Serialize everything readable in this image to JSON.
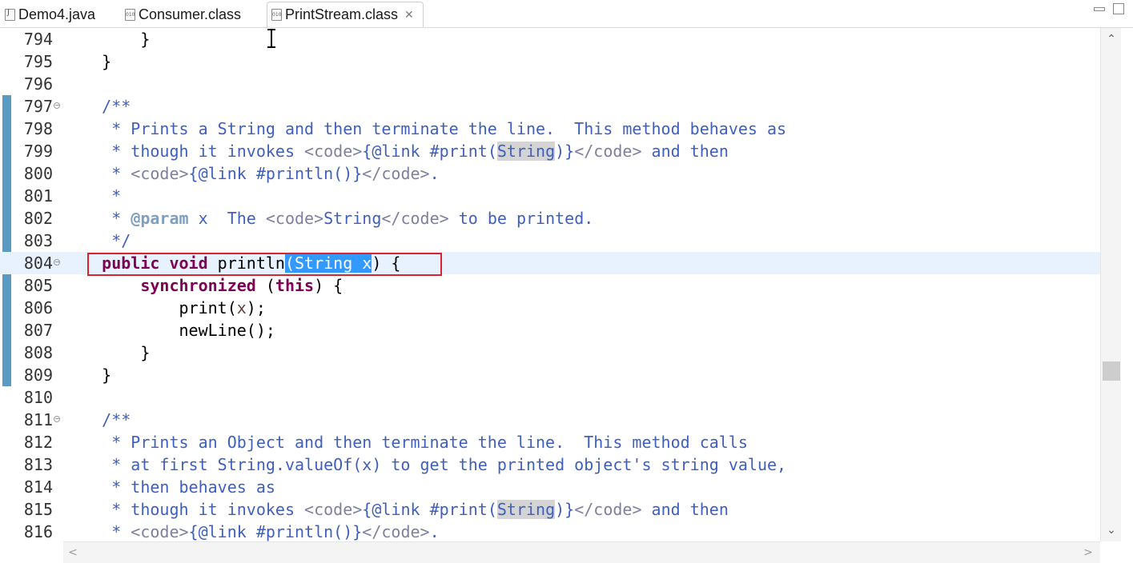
{
  "tabs": [
    {
      "label": "Demo4.java",
      "icon": "java-file-icon",
      "active": false
    },
    {
      "label": "Consumer.class",
      "icon": "class-file-icon",
      "active": false
    },
    {
      "label": "PrintStream.class",
      "icon": "class-file-icon",
      "active": true,
      "close": "✕"
    }
  ],
  "editor": {
    "current_line": 804,
    "lines": [
      {
        "n": "794",
        "tokens": [
          [
            "p",
            "        }"
          ]
        ]
      },
      {
        "n": "795",
        "tokens": [
          [
            "p",
            "    }"
          ]
        ]
      },
      {
        "n": "796",
        "tokens": []
      },
      {
        "n": "797",
        "fold": true,
        "tokens": [
          [
            "d",
            "    /**"
          ]
        ]
      },
      {
        "n": "798",
        "tokens": [
          [
            "d",
            "     * Prints a String and then terminate the line.  This method behaves as"
          ]
        ]
      },
      {
        "n": "799",
        "tokens": [
          [
            "d",
            "     * though it invokes "
          ],
          [
            "t",
            "<code>"
          ],
          [
            "d",
            "{@link #print("
          ],
          [
            "o",
            "String"
          ],
          [
            "d",
            ")}"
          ],
          [
            "t",
            "</code>"
          ],
          [
            "d",
            " and then"
          ]
        ]
      },
      {
        "n": "800",
        "tokens": [
          [
            "d",
            "     * "
          ],
          [
            "t",
            "<code>"
          ],
          [
            "d",
            "{@link #println()}"
          ],
          [
            "t",
            "</code>"
          ],
          [
            "d",
            "."
          ]
        ]
      },
      {
        "n": "801",
        "tokens": [
          [
            "d",
            "     *"
          ]
        ]
      },
      {
        "n": "802",
        "tokens": [
          [
            "d",
            "     * "
          ],
          [
            "b",
            "@param"
          ],
          [
            "d",
            " x  The "
          ],
          [
            "t",
            "<code>"
          ],
          [
            "d",
            "String"
          ],
          [
            "t",
            "</code>"
          ],
          [
            "d",
            " to be printed."
          ]
        ]
      },
      {
        "n": "803",
        "tokens": [
          [
            "d",
            "     */"
          ]
        ]
      },
      {
        "n": "804",
        "fold": true,
        "tokens": [
          [
            "p",
            "    "
          ],
          [
            "k",
            "public"
          ],
          [
            "p",
            " "
          ],
          [
            "k",
            "void"
          ],
          [
            "p",
            " println"
          ],
          [
            "s",
            "(String x"
          ],
          [
            "p",
            ") {"
          ]
        ]
      },
      {
        "n": "805",
        "tokens": [
          [
            "p",
            "        "
          ],
          [
            "k",
            "synchronized"
          ],
          [
            "p",
            " ("
          ],
          [
            "k",
            "this"
          ],
          [
            "p",
            ") {"
          ]
        ]
      },
      {
        "n": "806",
        "tokens": [
          [
            "p",
            "            print("
          ],
          [
            "v",
            "x"
          ],
          [
            "p",
            ");"
          ]
        ]
      },
      {
        "n": "807",
        "tokens": [
          [
            "p",
            "            newLine();"
          ]
        ]
      },
      {
        "n": "808",
        "tokens": [
          [
            "p",
            "        }"
          ]
        ]
      },
      {
        "n": "809",
        "tokens": [
          [
            "p",
            "    }"
          ]
        ]
      },
      {
        "n": "810",
        "tokens": []
      },
      {
        "n": "811",
        "fold": true,
        "tokens": [
          [
            "d",
            "    /**"
          ]
        ]
      },
      {
        "n": "812",
        "tokens": [
          [
            "d",
            "     * Prints an Object and then terminate the line.  This method calls"
          ]
        ]
      },
      {
        "n": "813",
        "tokens": [
          [
            "d",
            "     * at first String.valueOf(x) to get the printed object's string value,"
          ]
        ]
      },
      {
        "n": "814",
        "tokens": [
          [
            "d",
            "     * then behaves as"
          ]
        ]
      },
      {
        "n": "815",
        "tokens": [
          [
            "d",
            "     * though it invokes "
          ],
          [
            "t",
            "<code>"
          ],
          [
            "d",
            "{@link #print("
          ],
          [
            "o",
            "String"
          ],
          [
            "d",
            ")}"
          ],
          [
            "t",
            "</code>"
          ],
          [
            "d",
            " and then"
          ]
        ]
      },
      {
        "n": "816",
        "tokens": [
          [
            "d",
            "     * "
          ],
          [
            "t",
            "<code>"
          ],
          [
            "d",
            "{@link #println()}"
          ],
          [
            "t",
            "</code>"
          ],
          [
            "d",
            "."
          ]
        ]
      }
    ]
  },
  "scrollbar": {
    "vertical_position": 0.69,
    "up_arrow": "⌃",
    "down_arrow": "⌄",
    "left_arrow": "<",
    "right_arrow": ">"
  },
  "colors": {
    "keyword": "#7f0055",
    "javadoc": "#3f5fbf",
    "javadoc_tag": "#7f7f9f",
    "selection": "#3399ff",
    "current_line": "#e8f2fe",
    "annotation_box": "#d9232d"
  }
}
